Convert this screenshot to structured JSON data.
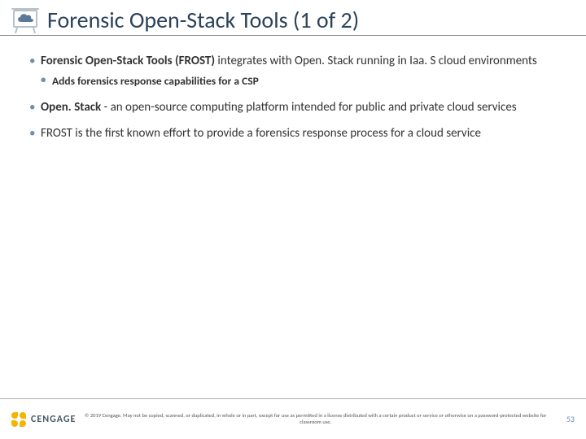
{
  "header": {
    "title": "Forensic Open-Stack Tools (1 of 2)",
    "icon": "cloud-presentation-icon"
  },
  "bullets": [
    {
      "text_lead": "Forensic Open-Stack Tools (FROST)",
      "text_rest": " integrates with Open. Stack running in Iaa. S cloud environments",
      "sub": [
        {
          "text": "Adds forensics response capabilities for a CSP"
        }
      ]
    },
    {
      "text_lead": "Open. Stack",
      "text_rest": " - an open-source computing platform intended for public and private cloud services"
    },
    {
      "text_lead": "FROST is the first known effort to provide a forensics response process for a cloud service",
      "text_rest": ""
    }
  ],
  "footer": {
    "brand": "CENGAGE",
    "copyright": "© 2019 Cengage. May not be copied, scanned, or duplicated, in whole or in part, except for use as permitted in a license distributed with a certain product or service or otherwise on a password-protected website for classroom use.",
    "page": "53"
  }
}
